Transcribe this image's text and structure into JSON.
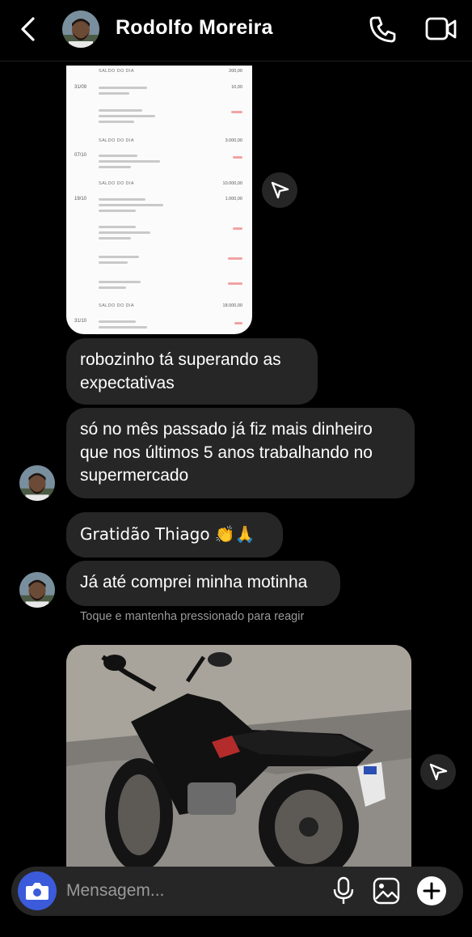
{
  "header": {
    "contact_name": "Rodolfo Moreira",
    "back_icon": "chevron-left-icon",
    "call_icon": "phone-icon",
    "video_icon": "video-camera-icon"
  },
  "statement": {
    "rows": [
      {
        "kind": "balance",
        "label": "SALDO DO DIA",
        "amount": "200,00"
      },
      {
        "kind": "entry",
        "date": "31/09",
        "amount": "10,00",
        "negative": false
      },
      {
        "kind": "entry",
        "date": "",
        "amount": "",
        "negative": true
      },
      {
        "kind": "balance",
        "label": "SALDO DO DIA",
        "amount": "3.000,00"
      },
      {
        "kind": "entry",
        "date": "07/10",
        "amount": "",
        "negative": true
      },
      {
        "kind": "balance",
        "label": "SALDO DO DIA",
        "amount": "10.000,00"
      },
      {
        "kind": "entry",
        "date": "19/10",
        "amount": "1.000,00",
        "negative": false
      },
      {
        "kind": "entry",
        "date": "",
        "amount": "",
        "negative": true
      },
      {
        "kind": "entry",
        "date": "",
        "amount": "",
        "negative": true
      },
      {
        "kind": "entry",
        "date": "",
        "amount": "",
        "negative": true
      },
      {
        "kind": "balance",
        "label": "SALDO DO DIA",
        "amount": "18.000,00"
      },
      {
        "kind": "entry",
        "date": "31/10",
        "amount": "",
        "negative": true
      }
    ]
  },
  "messages": [
    {
      "text": "robozinho tá superando as expectativas"
    },
    {
      "text": "só no mês passado já fiz mais dinheiro que nos últimos 5 anos trabalhando no supermercado"
    },
    {
      "text": "Gratidão Thiago 👏🙏"
    },
    {
      "text": "Já até comprei minha motinha"
    }
  ],
  "reaction_hint": "Toque e mantenha pressionado para reagir",
  "composer": {
    "placeholder": "Mensagem...",
    "camera_icon": "camera-icon",
    "mic_icon": "microphone-icon",
    "gallery_icon": "image-icon",
    "plus_icon": "plus-icon"
  },
  "colors": {
    "background": "#000000",
    "bubble": "#262626",
    "accent": "#3b5bdb",
    "hint": "#9a9a9a"
  }
}
